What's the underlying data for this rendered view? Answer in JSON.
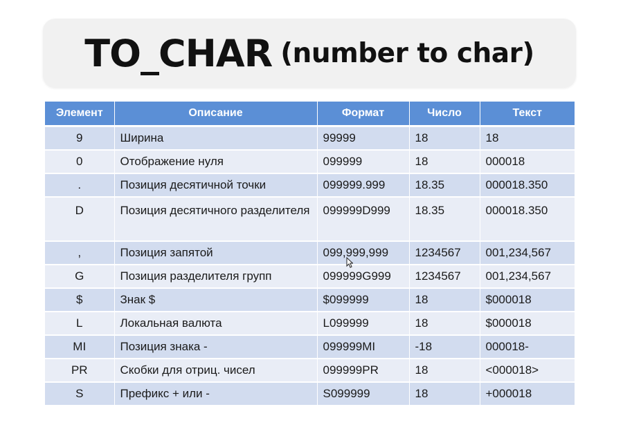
{
  "title": {
    "main": "TO_CHAR",
    "sub": "(number to char)"
  },
  "table": {
    "headers": [
      "Элемент",
      "Описание",
      "Формат",
      "Число",
      "Текст"
    ],
    "rows": [
      {
        "element": "9",
        "description": "Ширина",
        "format": "99999",
        "number": "18",
        "text": "18"
      },
      {
        "element": "0",
        "description": "Отображение нуля",
        "format": "099999",
        "number": "18",
        "text": "000018"
      },
      {
        "element": ".",
        "description": "Позиция десятичной точки",
        "format": "099999.999",
        "number": "18.35",
        "text": "000018.350"
      },
      {
        "element": "D",
        "description": "Позиция десятичного разделителя",
        "format": "099999D999",
        "number": "18.35",
        "text": "000018.350"
      },
      {
        "element": ",",
        "description": "Позиция запятой",
        "format": "099,999,999",
        "number": "1234567",
        "text": "001,234,567"
      },
      {
        "element": "G",
        "description": "Позиция разделителя групп",
        "format": "099999G999",
        "number": "1234567",
        "text": "001,234,567"
      },
      {
        "element": "$",
        "description": "Знак $",
        "format": "$099999",
        "number": "18",
        "text": "$000018"
      },
      {
        "element": "L",
        "description": "Локальная валюта",
        "format": "L099999",
        "number": "18",
        "text": "$000018"
      },
      {
        "element": "MI",
        "description": "Позиция знака -",
        "format": "099999MI",
        "number": "-18",
        "text": "000018-"
      },
      {
        "element": "PR",
        "description": "Скобки для отриц. чисел",
        "format": "099999PR",
        "number": "18",
        "text": "<000018>"
      },
      {
        "element": "S",
        "description": "Префикс + или -",
        "format": "S099999",
        "number": "18",
        "text": "+000018"
      }
    ]
  },
  "colors": {
    "header_bg": "#5b8fd6",
    "row_odd": "#d2dcef",
    "row_even": "#e9edf6"
  },
  "icons": {
    "cursor": "mouse-pointer-icon"
  }
}
